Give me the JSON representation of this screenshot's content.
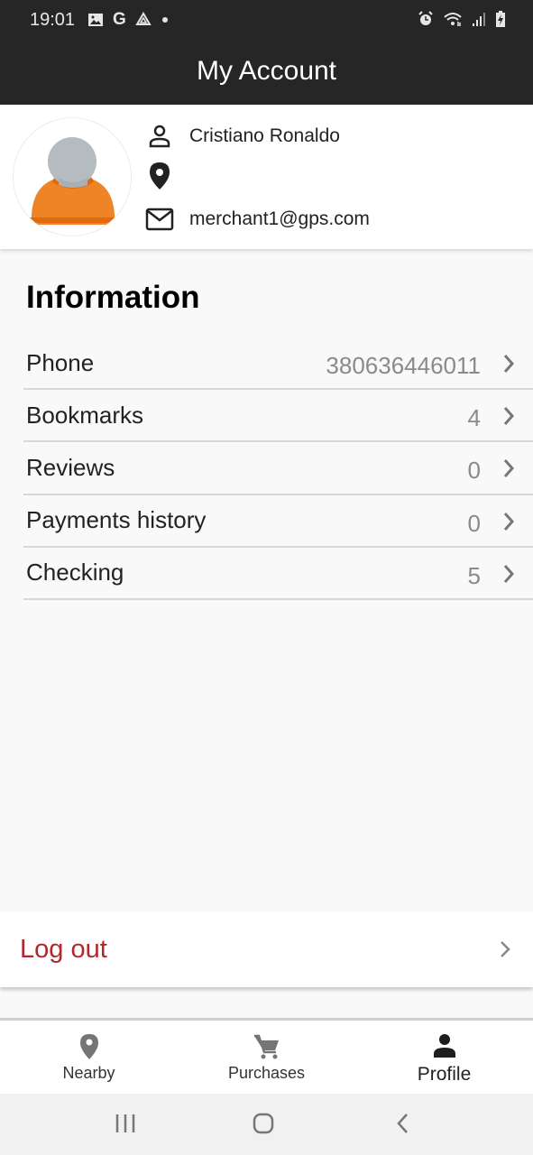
{
  "status_bar": {
    "time": "19:01",
    "left_icons": [
      "gallery-icon",
      "google-icon",
      "drive-icon",
      "dot-icon"
    ],
    "right_icons": [
      "alarm-icon",
      "wifi-icon",
      "signal-icon",
      "battery-charging-icon"
    ]
  },
  "app_bar": {
    "title": "My Account"
  },
  "profile": {
    "name": "Cristiano Ronaldo",
    "location": "",
    "email": "merchant1@gps.com"
  },
  "information": {
    "title": "Information",
    "items": [
      {
        "label": "Phone",
        "value": "380636446011"
      },
      {
        "label": "Bookmarks",
        "value": "4"
      },
      {
        "label": "Reviews",
        "value": "0"
      },
      {
        "label": "Payments history",
        "value": "0"
      },
      {
        "label": "Checking",
        "value": "5"
      }
    ]
  },
  "logout": {
    "label": "Log out"
  },
  "bottom_nav": {
    "items": [
      {
        "label": "Nearby",
        "icon": "location-pin-icon",
        "active": false
      },
      {
        "label": "Purchases",
        "icon": "cart-icon",
        "active": false
      },
      {
        "label": "Profile",
        "icon": "person-icon",
        "active": true
      }
    ]
  },
  "colors": {
    "app_bar": "#262626",
    "logout": "#b3262e",
    "avatar_body": "#ef8427",
    "avatar_head": "#b5bcc0"
  }
}
